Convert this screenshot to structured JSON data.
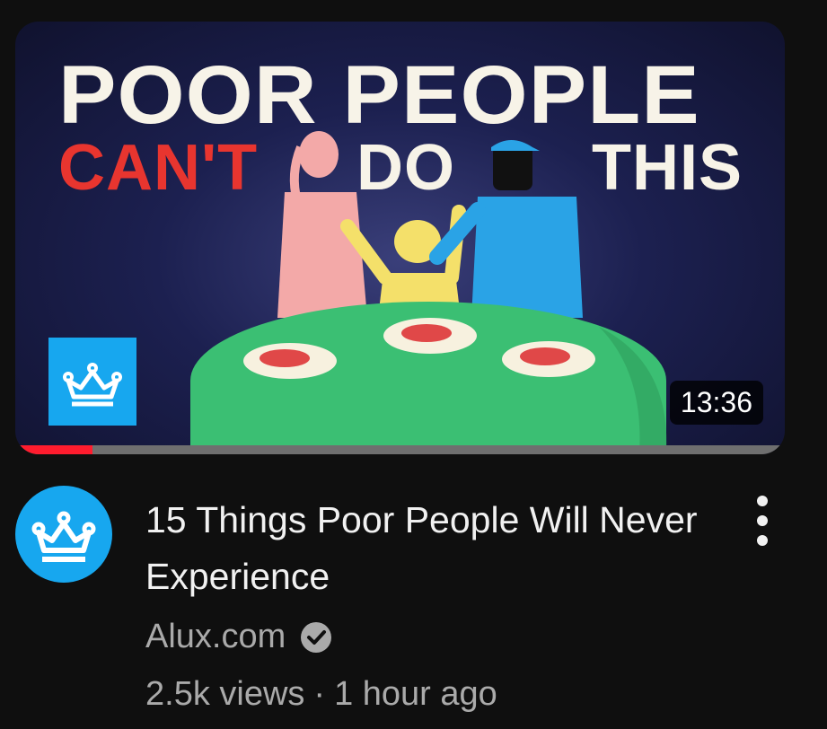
{
  "thumbnail": {
    "headline_line1": "POOR PEOPLE",
    "headline_word_red": "CAN'T",
    "headline_word_do": "DO",
    "headline_word_this": "THIS",
    "duration": "13:36",
    "watch_progress_percent": 10,
    "badge_icon": "crown-icon"
  },
  "video": {
    "title": "15 Things Poor People Will Never Experience",
    "channel": "Alux.com",
    "views": "2.5k views",
    "separator": "·",
    "age": "1 hour ago"
  },
  "icons": {
    "avatar": "crown-icon",
    "verified": "verified-check-icon",
    "menu": "more-vert-icon"
  },
  "colors": {
    "background": "#0f0f0f",
    "brand_blue": "#17a7ef",
    "progress_red": "#ff1c2e",
    "headline_red": "#e8352f"
  }
}
